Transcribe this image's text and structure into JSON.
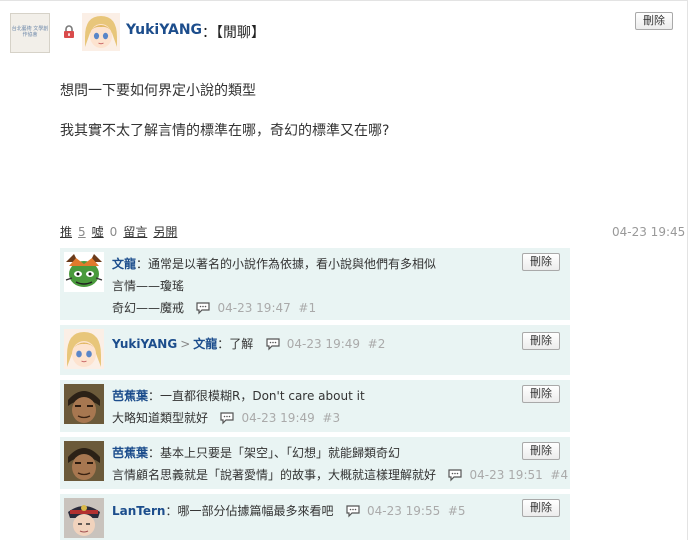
{
  "post": {
    "author": "YukiYANG",
    "colon": "：",
    "category": "【閒聊】",
    "avatar_caption": "台北藝術 文學創作協會",
    "body": [
      "想問一下要如何界定小說的類型",
      "我其實不太了解言情的標準在哪，奇幻的標準又在哪?"
    ],
    "delete_label": "刪除",
    "actions": {
      "push_label": "推",
      "push_count": "5",
      "boo_label": "噓",
      "boo_count": "0",
      "comment_label": "留言",
      "reply_label": "另開"
    },
    "timestamp": "04-23 19:45"
  },
  "comments": [
    {
      "name": "文龍",
      "text_line1": "：通常是以著名的小說作為依據，看小說與他們有多相似",
      "text_line2": "言情——瓊瑤",
      "text_line3": "奇幻——魔戒",
      "time": "04-23 19:47",
      "floor": "#1",
      "delete_label": "刪除"
    },
    {
      "name": "YukiYANG",
      "arrow": ">",
      "reply_to": "文龍",
      "text_line1": "：了解",
      "time": "04-23 19:49",
      "floor": "#2",
      "delete_label": "刪除"
    },
    {
      "name": "芭蕉葉",
      "text_line1": "：一直都很模糊R，Don't care about it",
      "text_line2": "大略知道類型就好",
      "time": "04-23 19:49",
      "floor": "#3",
      "delete_label": "刪除"
    },
    {
      "name": "芭蕉葉",
      "text_line1": "：基本上只要是「架空」、「幻想」就能歸類奇幻",
      "text_line2": "言情顧名思義就是「說著愛情」的故事，大概就這樣理解就好",
      "time": "04-23 19:51",
      "floor": "#4",
      "delete_label": "刪除"
    },
    {
      "name": "LanTern",
      "text_line1": "：哪一部分佔據篇幅最多來看吧",
      "time": "04-23 19:55",
      "floor": "#5",
      "delete_label": "刪除"
    }
  ],
  "colors": {
    "name_blue": "#1c4d8c",
    "comment_bg": "#e9f4f3",
    "meta_gray": "#aaaaaa"
  },
  "icons": {
    "lock": "lock-icon",
    "reply": "reply-bubble-icon"
  }
}
